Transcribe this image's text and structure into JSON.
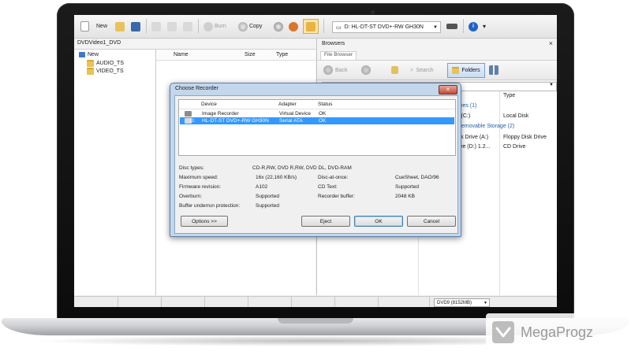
{
  "toolbar": {
    "new_label": "New",
    "burn_label": "Burn",
    "copy_label": "Copy",
    "drive_select": "D: HL-DT-ST DVD+-RW GH30N"
  },
  "left_panel": {
    "title": "DVDVideo1_DVD",
    "tree": {
      "root": "New",
      "children": [
        "AUDIO_TS",
        "VIDEO_TS"
      ]
    },
    "columns": [
      "Name",
      "Size",
      "Type"
    ]
  },
  "browsers": {
    "title": "Browsers",
    "close": "×",
    "tab": "File Browser",
    "nav": {
      "back": "Back",
      "search": "Search",
      "folders": "Folders"
    },
    "columns": [
      "Type"
    ],
    "rows": [
      {
        "text": "Drives (1)",
        "group": true
      },
      {
        "text": "isk (C:)",
        "type": "Local Disk"
      },
      {
        "text": "h Removable Storage (2)",
        "group": true
      },
      {
        "text": "Disk Drive (A:)",
        "type": "Floppy Disk Drive"
      },
      {
        "text": "Drive (D:) 1.2...",
        "type": "CD Drive"
      }
    ]
  },
  "status_bar": {
    "disc_type": "DVD9 (8152MB)"
  },
  "dialog": {
    "title": "Choose Recorder",
    "close": "×",
    "columns": [
      "Device",
      "Adapter",
      "Status"
    ],
    "rows": [
      {
        "device": "Image Recorder",
        "adapter": "Virtual Device",
        "status": "OK",
        "selected": false
      },
      {
        "drive": "D:",
        "device": "HL-DT-ST DVD+-RW GH30N",
        "adapter": "Serial ATA",
        "status": "OK",
        "selected": true
      }
    ],
    "props": {
      "disc_types_label": "Disc types:",
      "disc_types": "CD-R,RW, DVD R,RW, DVD DL, DVD-RAM",
      "max_speed_label": "Maximum speed:",
      "max_speed": "16x (22,160 KB/s)",
      "disc_at_once_label": "Disc-at-once:",
      "disc_at_once": "CueSheet, DAO/96",
      "firmware_label": "Firmware revision:",
      "firmware": "A102",
      "cd_text_label": "CD Text:",
      "cd_text": "Supported",
      "overburn_label": "Overburn:",
      "overburn": "Supported",
      "recorder_buffer_label": "Recorder buffer:",
      "recorder_buffer": "2048 KB",
      "underrun_label": "Buffer underrun protection:",
      "underrun": "Supported"
    },
    "buttons": {
      "options": "Options >>",
      "eject": "Eject",
      "ok": "OK",
      "cancel": "Cancel"
    }
  },
  "watermark": "MegaProgz",
  "colors": {
    "selection": "#3399ff",
    "dialog_frame": "#c2d6ec",
    "group_text": "#1f5fa8"
  }
}
